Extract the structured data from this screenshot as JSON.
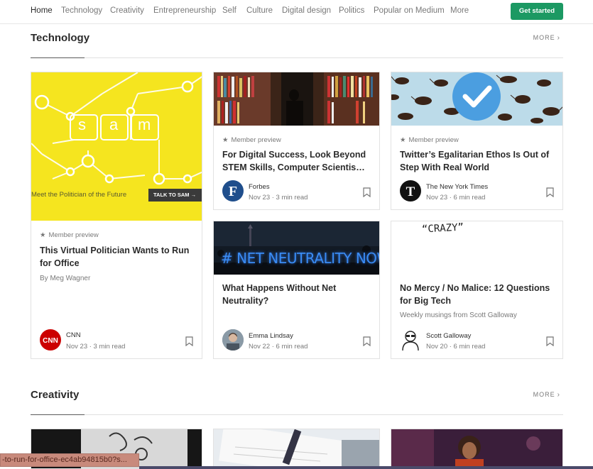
{
  "nav": {
    "items": [
      "Home",
      "Technology",
      "Creativity",
      "Entrepreneurship",
      "Self",
      "Culture",
      "Digital design",
      "Politics",
      "Popular on Medium",
      "More"
    ],
    "cta": "Get started"
  },
  "sections": [
    {
      "title": "Technology",
      "more": "MORE"
    },
    {
      "title": "Creativity",
      "more": "MORE"
    }
  ],
  "cards": [
    {
      "badge": "Member preview",
      "title": "This Virtual Politician Wants to Run for Office",
      "subtitle": "By Meg Wagner",
      "author": "CNN",
      "meta": "Nov 23 · 3 min read",
      "image_text": {
        "letters": [
          "s",
          "a",
          "m"
        ],
        "caption": "Meet the Politician of the Future",
        "button": "TALK TO SAM →"
      }
    },
    {
      "badge": "Member preview",
      "title": "For Digital Success, Look Beyond STEM Skills, Computer Scientis…",
      "author": "Forbes",
      "meta": "Nov 23 · 3 min read"
    },
    {
      "badge": "Member preview",
      "title": "Twitter’s Egalitarian Ethos Is Out of Step With Real World",
      "author": "The New York Times",
      "meta": "Nov 23 · 6 min read"
    },
    {
      "title": "What Happens Without Net Neutrality?",
      "author": "Emma Lindsay",
      "meta": "Nov 22 · 6 min read",
      "image_text": "# NET NEUTRALITY NOW"
    },
    {
      "title": "No Mercy / No Malice: 12 Questions for Big Tech",
      "subtitle": "Weekly musings from Scott Galloway",
      "author": "Scott Galloway",
      "meta": "Nov 20 · 6 min read",
      "image_text": "“CRAZY”"
    }
  ],
  "status_url": "-to-run-for-office-ec4ab94815b0?s...",
  "colors": {
    "accent": "#1c9963",
    "cnn_red": "#cc0000",
    "forbes_blue": "#1f4e8c",
    "sam_yellow": "#f5e51f"
  }
}
